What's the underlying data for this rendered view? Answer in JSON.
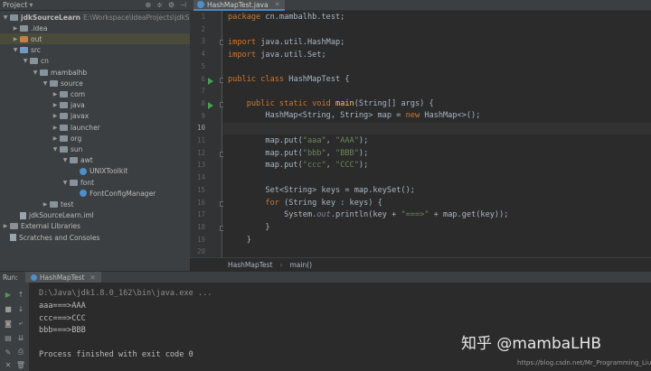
{
  "project_panel": {
    "header_label": "Project",
    "tree": [
      {
        "label": "jdkSourceLearn",
        "extra": "E:\\Workspace\\IdeaProjects\\jdkSource",
        "depth": 0,
        "type": "folder-plain",
        "expanded": true
      },
      {
        "label": ".idea",
        "depth": 1,
        "type": "folder-plain",
        "expanded": false
      },
      {
        "label": "out",
        "depth": 1,
        "type": "folder-orange",
        "expanded": false
      },
      {
        "label": "src",
        "depth": 1,
        "type": "folder-blue",
        "expanded": true
      },
      {
        "label": "cn",
        "depth": 2,
        "type": "folder-plain",
        "expanded": true
      },
      {
        "label": "mambalhb",
        "depth": 3,
        "type": "folder-plain",
        "expanded": true
      },
      {
        "label": "source",
        "depth": 4,
        "type": "folder-plain",
        "expanded": true
      },
      {
        "label": "com",
        "depth": 5,
        "type": "folder-plain",
        "expanded": false
      },
      {
        "label": "java",
        "depth": 5,
        "type": "folder-plain",
        "expanded": false
      },
      {
        "label": "javax",
        "depth": 5,
        "type": "folder-plain",
        "expanded": false
      },
      {
        "label": "launcher",
        "depth": 5,
        "type": "folder-plain",
        "expanded": false
      },
      {
        "label": "org",
        "depth": 5,
        "type": "folder-plain",
        "expanded": false
      },
      {
        "label": "sun",
        "depth": 5,
        "type": "folder-plain",
        "expanded": true
      },
      {
        "label": "awt",
        "depth": 6,
        "type": "folder-plain",
        "expanded": true
      },
      {
        "label": "UNIXToolkit",
        "depth": 7,
        "type": "class"
      },
      {
        "label": "font",
        "depth": 6,
        "type": "folder-plain",
        "expanded": true
      },
      {
        "label": "FontConfigManager",
        "depth": 7,
        "type": "class"
      },
      {
        "label": "test",
        "depth": 4,
        "type": "folder-plain",
        "expanded": false
      },
      {
        "label": "jdkSourceLearn.iml",
        "depth": 1,
        "type": "file"
      },
      {
        "label": "External Libraries",
        "depth": 0,
        "type": "lib",
        "expanded": false
      },
      {
        "label": "Scratches and Consoles",
        "depth": 0,
        "type": "scratch"
      }
    ]
  },
  "editor": {
    "tab_label": "HashMapTest.java",
    "line_numbers": [
      "1",
      "2",
      "3",
      "4",
      "5",
      "6",
      "7",
      "8",
      "9",
      "10",
      "11",
      "12",
      "13",
      "14",
      "15",
      "16",
      "17",
      "18",
      "19",
      "20"
    ],
    "current_line": "10",
    "breadcrumb": [
      "HashMapTest",
      "main()"
    ]
  },
  "run_panel": {
    "label": "Run:",
    "tab_label": "HashMapTest",
    "console_lines": [
      "D:\\Java\\jdk1.8.0_162\\bin\\java.exe ...",
      "aaa===>AAA",
      "ccc===>CCC",
      "bbb===>BBB",
      "",
      "Process finished with exit code 0"
    ]
  },
  "watermark": {
    "text": "知乎 @mambaLHB",
    "url": "https://blog.csdn.net/Mr_Programming_Liu"
  }
}
